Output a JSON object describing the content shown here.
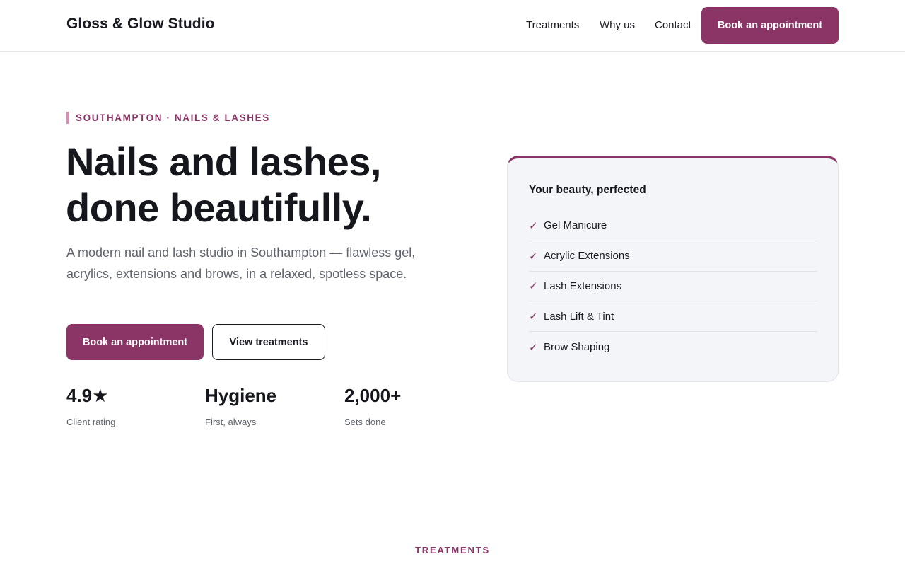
{
  "header": {
    "brand": "Gloss & Glow Studio",
    "nav": [
      "Treatments",
      "Why us",
      "Contact"
    ],
    "cta": "Book an appointment"
  },
  "hero": {
    "eyebrow": "SOUTHAMPTON · NAILS & LASHES",
    "title_line1": "Nails and lashes,",
    "title_line2": "done beautifully.",
    "description": "A modern nail and lash studio in Southampton — flawless gel, acrylics, extensions and brows, in a relaxed, spotless space.",
    "primary_button": "Book an appointment",
    "secondary_button": "View treatments",
    "stats": [
      {
        "value": "4.9★",
        "label": "Client rating"
      },
      {
        "value": "Hygiene",
        "label": "First, always"
      },
      {
        "value": "2,000+",
        "label": "Sets done"
      }
    ]
  },
  "card": {
    "title": "Your beauty, perfected",
    "check_glyph": "✓",
    "items": [
      "Gel Manicure",
      "Acrylic Extensions",
      "Lash Extensions",
      "Lash Lift & Tint",
      "Brow Shaping"
    ]
  },
  "next_section": {
    "label": "TREATMENTS"
  },
  "colors": {
    "accent": "#8a3566",
    "accent_light": "#d48fb3",
    "text": "#16171d",
    "muted": "#60636d",
    "card_bg": "#f4f5f8"
  }
}
